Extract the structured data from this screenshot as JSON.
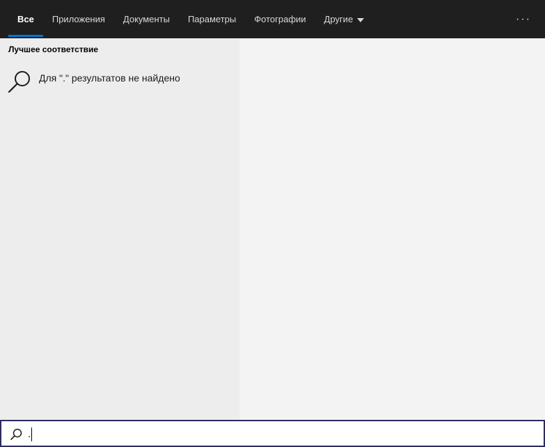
{
  "tabs": [
    {
      "label": "Все",
      "active": true
    },
    {
      "label": "Приложения",
      "active": false
    },
    {
      "label": "Документы",
      "active": false
    },
    {
      "label": "Параметры",
      "active": false
    },
    {
      "label": "Фотографии",
      "active": false
    },
    {
      "label": "Другие",
      "active": false,
      "dropdown": true
    }
  ],
  "more_label": "···",
  "best_match": {
    "title": "Лучшее соответствие",
    "result_text": "Для \".\" результатов не найдено",
    "icon": "magnifier-icon"
  },
  "search": {
    "value": ".",
    "icon": "search-icon"
  },
  "colors": {
    "topbar": "#1f1f1f",
    "accent": "#0078d4",
    "left_pane": "#ededed",
    "right_pane": "#f3f3f3",
    "search_border": "#2b2b5e"
  }
}
